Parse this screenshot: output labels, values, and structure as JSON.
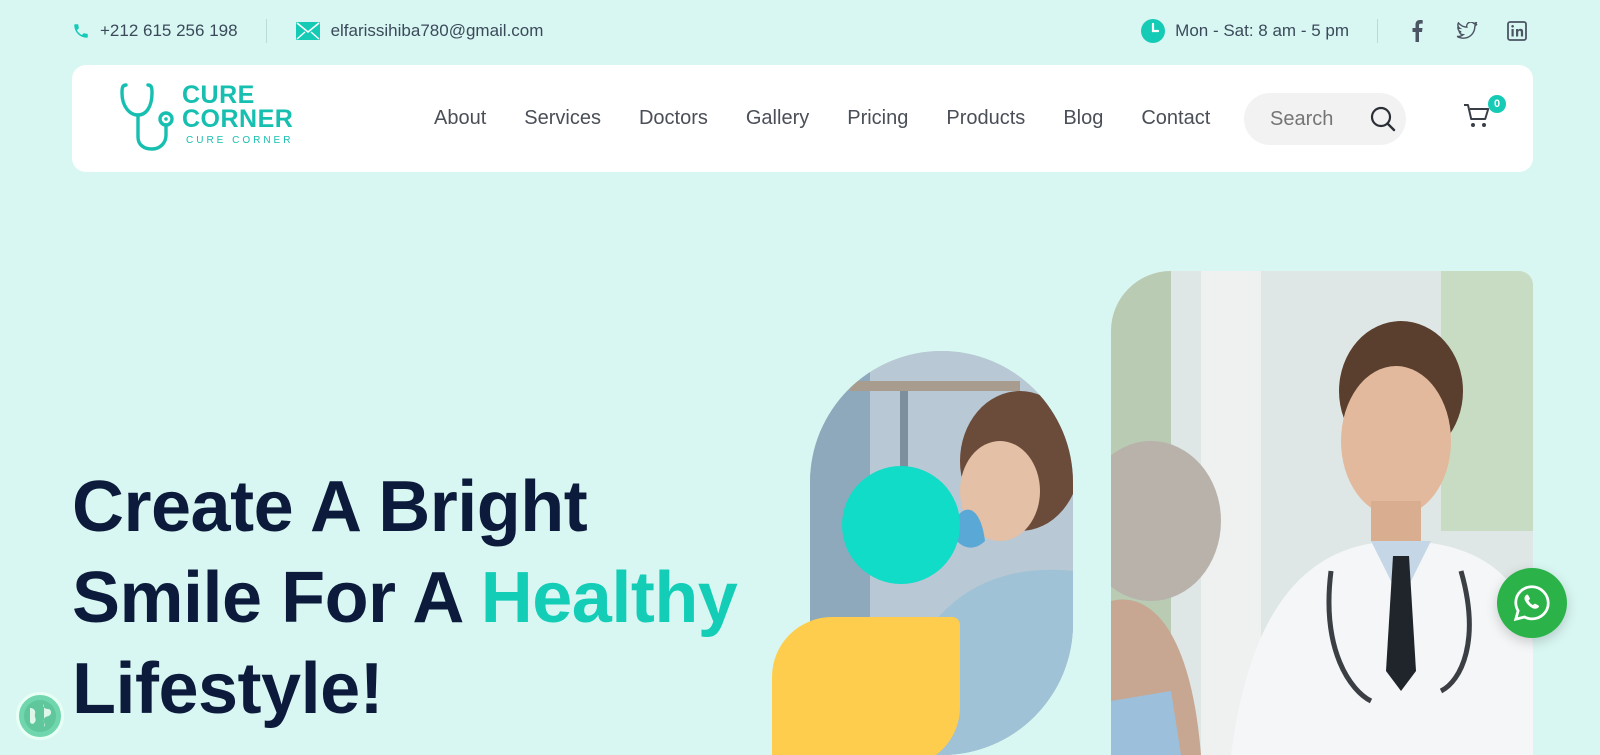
{
  "topbar": {
    "phone": "+212 615 256 198",
    "email": "elfarissihiba780@gmail.com",
    "hours": "Mon - Sat: 8 am - 5 pm",
    "social_icons": [
      "facebook-icon",
      "twitter-icon",
      "linkedin-icon"
    ]
  },
  "brand": {
    "name_line1": "CURE",
    "name_line2": "CORNER",
    "tagline": "CURE CORNER",
    "accent": "#16cbb5"
  },
  "nav": {
    "items": [
      {
        "label": "About"
      },
      {
        "label": "Services"
      },
      {
        "label": "Doctors"
      },
      {
        "label": "Gallery"
      },
      {
        "label": "Pricing"
      },
      {
        "label": "Products"
      },
      {
        "label": "Blog"
      },
      {
        "label": "Contact"
      }
    ]
  },
  "search": {
    "placeholder": "Search"
  },
  "cart": {
    "count": "0"
  },
  "hero": {
    "title_part1": "Create A Bright",
    "title_part2": "Smile For A ",
    "title_highlight": "Healthy",
    "title_part3": "Lifestyle!"
  },
  "colors": {
    "background": "#d9f7f2",
    "heading": "#0c1b3b",
    "highlight": "#14cdb7",
    "yellow": "#ffcd4d",
    "whatsapp": "#2bb34a"
  }
}
